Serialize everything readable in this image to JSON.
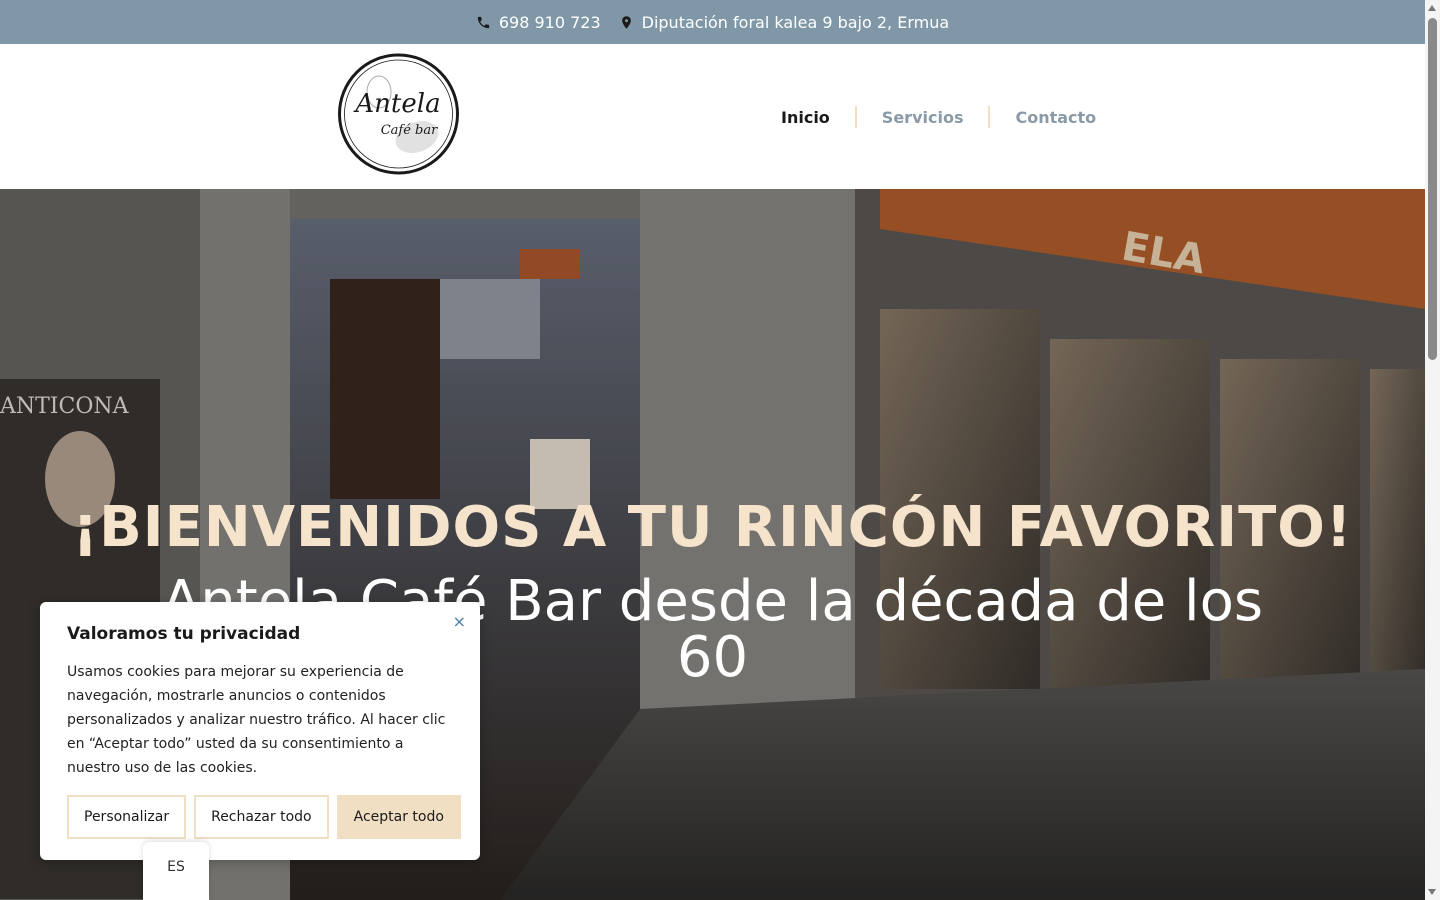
{
  "topbar": {
    "phone": "698 910 723",
    "address": "Diputación foral kalea 9 bajo 2, Ermua",
    "phone_icon": "phone-icon",
    "address_icon": "map-pin-icon",
    "background": "#7f97a7"
  },
  "header": {
    "logo_text_main": "Antela",
    "logo_text_sub": "Café bar",
    "nav": [
      {
        "label": "Inicio",
        "active": true
      },
      {
        "label": "Servicios",
        "active": false
      },
      {
        "label": "Contacto",
        "active": false
      }
    ]
  },
  "hero": {
    "title": "¡BIENVENIDOS A TU RINCÓN FAVORITO!",
    "subtitle": "Antela Café Bar desde la década de los 60",
    "sign_left": "ANTICONA",
    "sign_awning": "ELA"
  },
  "cookie": {
    "title": "Valoramos tu privacidad",
    "body": "Usamos cookies para mejorar su experiencia de navegación, mostrarle anuncios o contenidos personalizados y analizar nuestro tráfico. Al hacer clic en “Aceptar todo” usted da su consentimiento a nuestro uso de las cookies.",
    "close": "×",
    "buttons": {
      "customize": "Personalizar",
      "reject": "Rechazar todo",
      "accept": "Aceptar todo"
    },
    "accent": "#f1dfc4"
  },
  "language": "ES"
}
